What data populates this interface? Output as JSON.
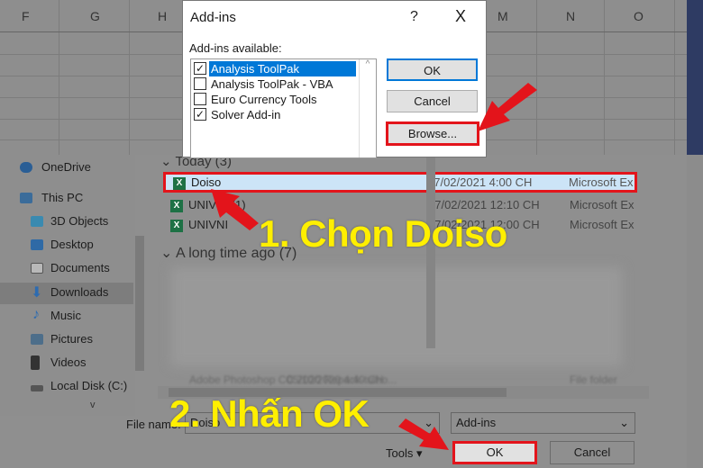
{
  "excel": {
    "columns": [
      "F",
      "G",
      "H",
      "M",
      "N",
      "O"
    ]
  },
  "addins_dialog": {
    "title": "Add-ins",
    "help": "?",
    "close": "X",
    "list_label": "Add-ins available:",
    "items": [
      {
        "label": "Analysis ToolPak",
        "checked": true,
        "selected": true
      },
      {
        "label": "Analysis ToolPak - VBA",
        "checked": false
      },
      {
        "label": "Euro Currency Tools",
        "checked": false
      },
      {
        "label": "Solver Add-in",
        "checked": true
      }
    ],
    "ok": "OK",
    "cancel": "Cancel",
    "browse": "Browse..."
  },
  "file_dialog": {
    "sidebar": [
      "OneDrive",
      "This PC",
      "3D Objects",
      "Desktop",
      "Documents",
      "Downloads",
      "Music",
      "Pictures",
      "Videos",
      "Local Disk (C:)"
    ],
    "selected_sidebar": "Downloads",
    "group_today": "Today (3)",
    "files": [
      {
        "name": "Doiso",
        "date": "17/02/2021 4:00 CH",
        "type": "Microsoft Ex"
      },
      {
        "name": "UNIVNI (1)",
        "date": "17/02/2021 12:10 CH",
        "type": "Microsoft Ex"
      },
      {
        "name": "UNIVNI",
        "date": "17/02/2021 12:00 CH",
        "type": "Microsoft Ex"
      }
    ],
    "group_old": "A long time ago (7)",
    "blurred_row": {
      "name": "Adobe Photoshop CC 2020 Repack-tuiho...",
      "date": "05/10/2020 4:40 CH",
      "type": "File folder"
    },
    "filename_label": "File name:",
    "filename_value": "Doiso",
    "filter": "Add-ins",
    "tools": "Tools",
    "ok": "OK",
    "cancel": "Cancel"
  },
  "annotations": {
    "step1": "1. Chọn Doiso",
    "step2": "2. Nhấn OK"
  },
  "colors": {
    "highlight": "#e3141b",
    "annotation": "#ffef00",
    "selection": "#cce4f7"
  }
}
